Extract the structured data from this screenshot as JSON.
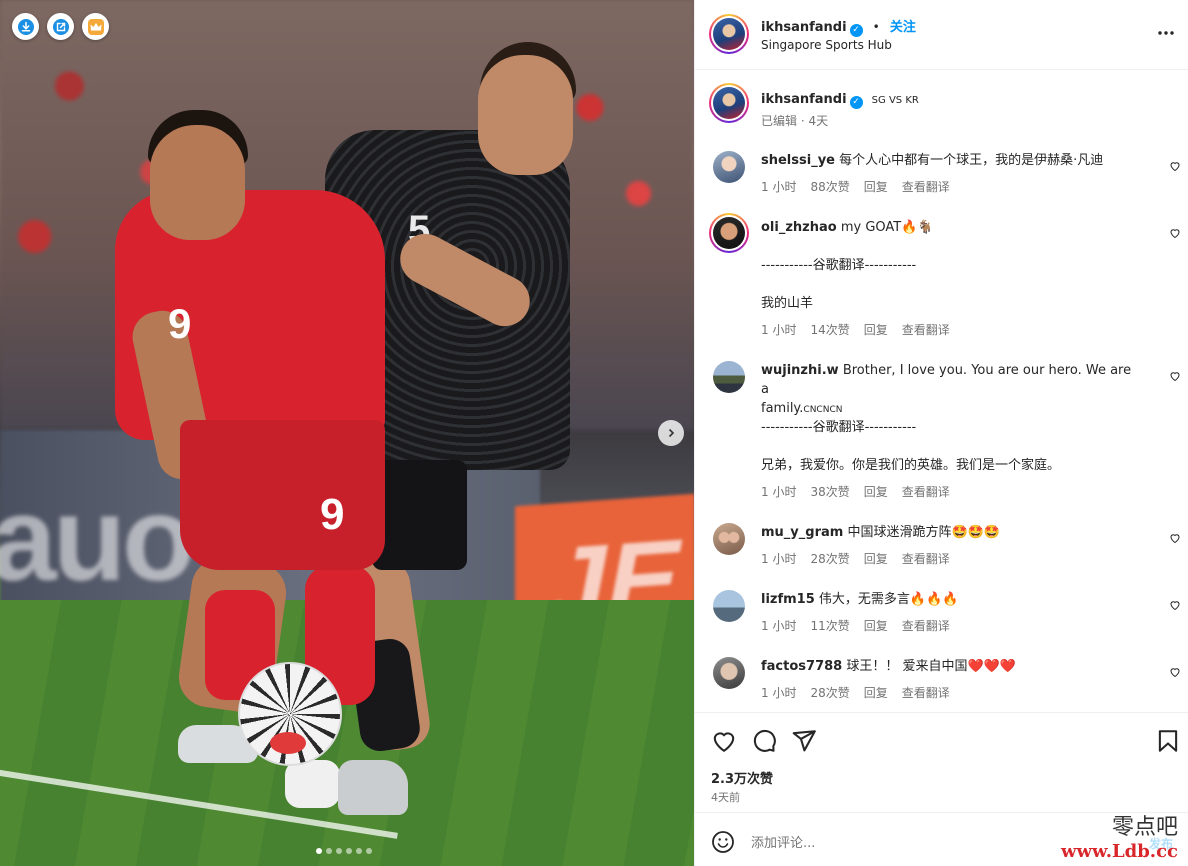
{
  "photo": {
    "buttons": [
      "download-icon",
      "open-external-icon",
      "crown-icon"
    ],
    "next_icon": "chevron-right-icon",
    "carousel": {
      "count": 6,
      "active": 0
    },
    "jersey_numbers": {
      "red_front": "9",
      "red_shorts": "9",
      "black_front": "5"
    },
    "board_text": "auo",
    "orange_board_text": "JE"
  },
  "header": {
    "username": "ikhsanfandi",
    "separator": "•",
    "follow_label": "关注",
    "location": "Singapore Sports Hub",
    "more_icon": "more-horizontal-icon"
  },
  "caption": {
    "username": "ikhsanfandi",
    "text": "SG VS KR",
    "edited": "已编辑 · 4天"
  },
  "comments": [
    {
      "user": "shelssi_ye",
      "text": "每个人心中都有一个球王，我的是伊赫桑·凡迪",
      "time": "1 小时",
      "likes": "88次赞",
      "reply": "回复",
      "translate": "查看翻译"
    },
    {
      "user": "oli_zhzhao",
      "text": "my GOAT🔥🐐",
      "divider": "-----------谷歌翻译-----------",
      "translation": "我的山羊",
      "time": "1 小时",
      "likes": "14次赞",
      "reply": "回复",
      "translate": "查看翻译"
    },
    {
      "user": "wujinzhi.w",
      "text": "Brother, I love you. You are our hero. We are a",
      "text2": "family.",
      "suffix": "CNCNCN",
      "divider": "-----------谷歌翻译-----------",
      "translation": "兄弟，我爱你。你是我们的英雄。我们是一个家庭。",
      "time": "1 小时",
      "likes": "38次赞",
      "reply": "回复",
      "translate": "查看翻译"
    },
    {
      "user": "mu_y_gram",
      "text": "中国球迷滑跪方阵🤩🤩🤩",
      "time": "1 小时",
      "likes": "28次赞",
      "reply": "回复",
      "translate": "查看翻译"
    },
    {
      "user": "lizfm15",
      "text": "伟大，无需多言🔥🔥🔥",
      "time": "1 小时",
      "likes": "11次赞",
      "reply": "回复",
      "translate": "查看翻译"
    },
    {
      "user": "factos7788",
      "text": "球王！！ 爱来自中国❤️❤️❤️",
      "time": "1 小时",
      "likes": "28次赞",
      "reply": "回复",
      "translate": "查看翻译"
    }
  ],
  "actions": {
    "likes": "2.3万次赞",
    "posted": "4天前",
    "icons": [
      "heart-icon",
      "comment-icon",
      "share-icon",
      "bookmark-icon"
    ]
  },
  "add_comment": {
    "placeholder": "添加评论...",
    "post_label": "发布",
    "emoji_icon": "emoji-icon"
  },
  "watermark": {
    "line1": "零点吧",
    "line2": "www.Ldb.cc"
  }
}
